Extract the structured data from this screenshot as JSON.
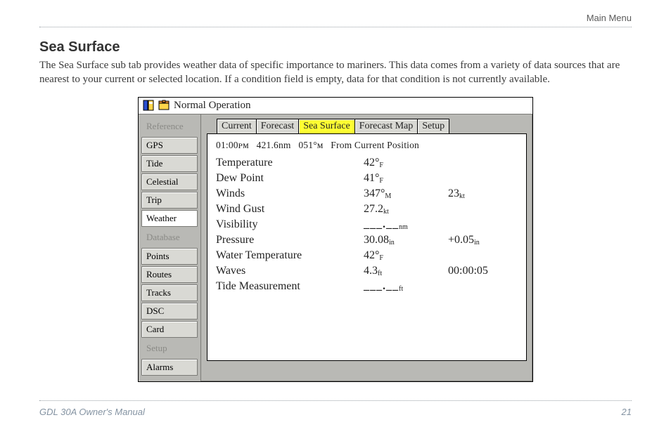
{
  "doc": {
    "header_right": "Main Menu",
    "section_title": "Sea Surface",
    "section_body": "The Sea Surface sub tab provides weather data of specific importance to mariners. This data comes from a variety of data sources that are nearest to your current or selected location. If a condition field is empty, data for that condition is not currently available.",
    "footer_left": "GDL 30A Owner's Manual",
    "footer_right": "21"
  },
  "device": {
    "title": "Normal Operation",
    "sidebar": [
      {
        "label": "Reference",
        "kind": "section"
      },
      {
        "label": "GPS",
        "kind": "item"
      },
      {
        "label": "Tide",
        "kind": "item"
      },
      {
        "label": "Celestial",
        "kind": "item"
      },
      {
        "label": "Trip",
        "kind": "item"
      },
      {
        "label": "Weather",
        "kind": "item",
        "active": true
      },
      {
        "label": "Database",
        "kind": "section"
      },
      {
        "label": "Points",
        "kind": "item"
      },
      {
        "label": "Routes",
        "kind": "item"
      },
      {
        "label": "Tracks",
        "kind": "item"
      },
      {
        "label": "DSC",
        "kind": "item"
      },
      {
        "label": "Card",
        "kind": "item"
      },
      {
        "label": "Setup",
        "kind": "section"
      },
      {
        "label": "Alarms",
        "kind": "item"
      }
    ],
    "subtabs": [
      {
        "label": "Current"
      },
      {
        "label": "Forecast"
      },
      {
        "label": "Sea Surface",
        "active": true
      },
      {
        "label": "Forecast Map"
      },
      {
        "label": "Setup"
      }
    ],
    "status": {
      "time": "01:00ᴘᴍ",
      "distance": "421.6nm",
      "bearing": "051°ᴍ",
      "from": "From Current Position"
    },
    "rows": [
      {
        "label": "Temperature",
        "v1": "42°",
        "u1": "F",
        "v2": ""
      },
      {
        "label": "Dew Point",
        "v1": "41°",
        "u1": "F",
        "v2": ""
      },
      {
        "label": "Winds",
        "v1": "347°",
        "u1": "M",
        "v2": "23",
        "u2": "kt"
      },
      {
        "label": "Wind Gust",
        "v1": "27.2",
        "u1": "kt",
        "v2": ""
      },
      {
        "label": "Visibility",
        "v1": "___.__",
        "u1": "nm",
        "v2": "",
        "dash": true
      },
      {
        "label": "Pressure",
        "v1": "30.08",
        "u1": "in",
        "v2": "+0.05",
        "u2": "in"
      },
      {
        "label": "Water Temperature",
        "v1": "42°",
        "u1": "F",
        "v2": ""
      },
      {
        "label": "Waves",
        "v1": "4.3",
        "u1": "ft",
        "v2": "00:00:05"
      },
      {
        "label": "Tide Measurement",
        "v1": "___.__",
        "u1": "ft",
        "v2": "",
        "dash": true
      }
    ]
  }
}
